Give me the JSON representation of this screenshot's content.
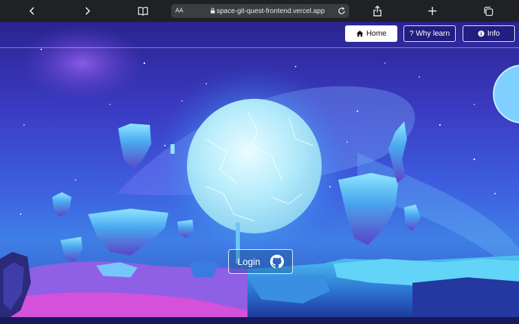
{
  "browser": {
    "text_size_label": "AA",
    "url": "space-git-quest-frontend.vercel.app"
  },
  "nav": {
    "home_label": "Home",
    "why_learn_label": "? Why learn",
    "info_label": "Info"
  },
  "login": {
    "label": "Login"
  },
  "icons": {
    "home": "home-icon",
    "info": "info-icon",
    "github": "github-icon"
  },
  "colors": {
    "nav_active_bg": "#ffffff",
    "nav_border": "#e9ecff",
    "planet_glow": "#bff3ff"
  }
}
